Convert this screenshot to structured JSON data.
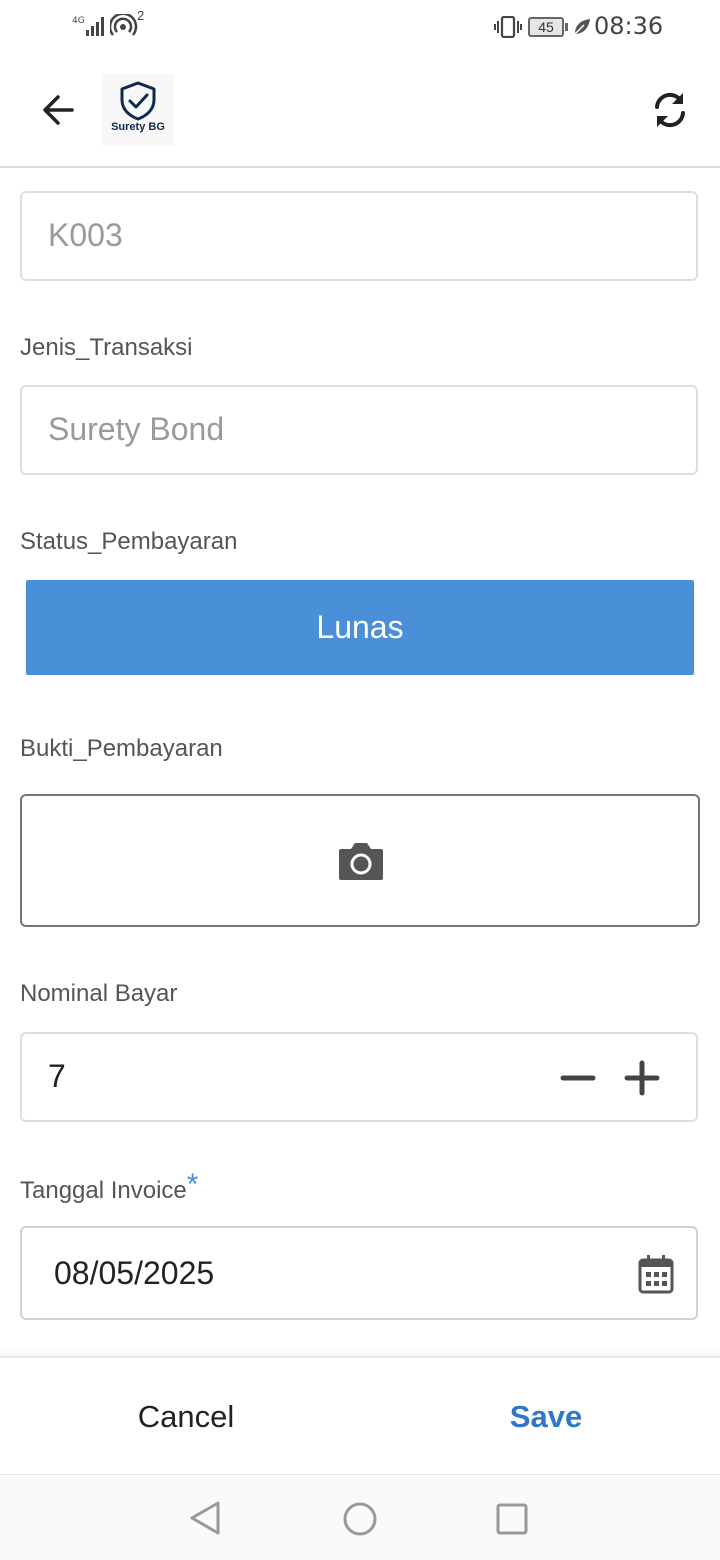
{
  "status_bar": {
    "network_label": "4G",
    "wifi_badge": "2",
    "battery_level": "45",
    "time": "08:36"
  },
  "header": {
    "logo_text": "Surety BG",
    "back_icon": "arrow-left-icon",
    "refresh_icon": "sync-icon"
  },
  "form": {
    "code_field": {
      "placeholder": "K003"
    },
    "jenis_transaksi": {
      "label": "Jenis_Transaksi",
      "placeholder": "Surety Bond"
    },
    "status_pembayaran": {
      "label": "Status_Pembayaran",
      "selected": "Lunas"
    },
    "bukti_pembayaran": {
      "label": "Bukti_Pembayaran",
      "icon": "camera-icon"
    },
    "nominal_bayar": {
      "label": "Nominal Bayar",
      "value": "7"
    },
    "tanggal_invoice": {
      "label": "Tanggal Invoice",
      "required_mark": "*",
      "value": "08/05/2025"
    }
  },
  "actions": {
    "cancel_label": "Cancel",
    "save_label": "Save"
  },
  "colors": {
    "accent": "#4a90d9",
    "save_text": "#2d79c7"
  }
}
